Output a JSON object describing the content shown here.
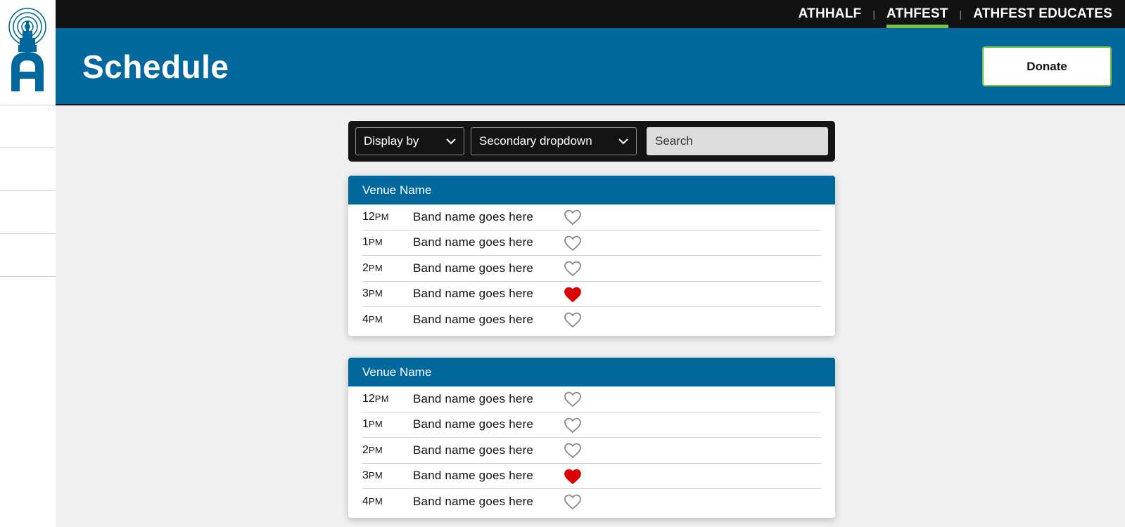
{
  "topnav": {
    "links": [
      "ATHHALF",
      "ATHFEST",
      "ATHFEST EDUCATES"
    ],
    "separator": "|",
    "active": "ATHFEST",
    "active_underline_color": "#7ec043"
  },
  "header": {
    "title": "Schedule",
    "donate_label": "Donate",
    "background_color": "#00689d"
  },
  "filters": {
    "display_by_label": "Display by",
    "secondary_label": "Secondary dropdown",
    "search_placeholder": "Search"
  },
  "venues": [
    {
      "name": "Venue Name",
      "slots": [
        {
          "hour": "12",
          "ampm": "PM",
          "band": "Band name goes here",
          "favorited": false
        },
        {
          "hour": "1",
          "ampm": "PM",
          "band": "Band name goes here",
          "favorited": false
        },
        {
          "hour": "2",
          "ampm": "PM",
          "band": "Band name goes here",
          "favorited": false
        },
        {
          "hour": "3",
          "ampm": "PM",
          "band": "Band name goes here",
          "favorited": true
        },
        {
          "hour": "4",
          "ampm": "PM",
          "band": "Band name goes here",
          "favorited": false
        }
      ]
    },
    {
      "name": "Venue Name",
      "slots": [
        {
          "hour": "12",
          "ampm": "PM",
          "band": "Band name goes here",
          "favorited": false
        },
        {
          "hour": "1",
          "ampm": "PM",
          "band": "Band name goes here",
          "favorited": false
        },
        {
          "hour": "2",
          "ampm": "PM",
          "band": "Band name goes here",
          "favorited": false
        },
        {
          "hour": "3",
          "ampm": "PM",
          "band": "Band name goes here",
          "favorited": true
        },
        {
          "hour": "4",
          "ampm": "PM",
          "band": "Band name goes here",
          "favorited": false
        }
      ]
    }
  ],
  "icons": {
    "logo": "athfest-tower-logo-icon",
    "dropdown": "chevron-down-icon",
    "favorite": "heart-icon"
  },
  "colors": {
    "heart_active": "#dd0000",
    "heart_inactive": "#888888"
  }
}
